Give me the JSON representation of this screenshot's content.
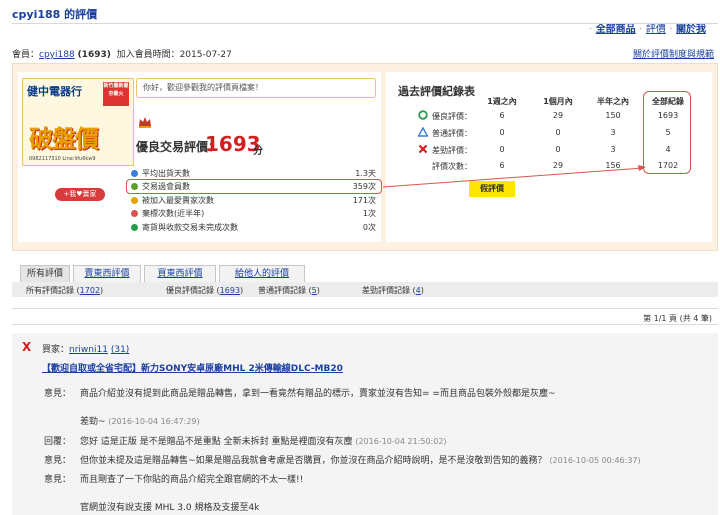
{
  "header": {
    "title": "cpyi188 的評價",
    "links": [
      "全部商品",
      "評價",
      "關於我"
    ],
    "member_prefix": "會員：",
    "member_name": "cpyi188",
    "member_count": "(1693)",
    "joined": "加入會員時間：2015-07-27",
    "rules_link": "關於評價制度與規範"
  },
  "promo": {
    "brand": "健中電器行",
    "stamp": "新竹最新最夯最火",
    "big": "破盤價",
    "small": "0982117310 Line:lifu6kw9"
  },
  "favorite_button": "+我♥賣家",
  "welcome": "你好，歡迎參觀我的評價頁檔案！",
  "rating": {
    "label": "優良交易評價：",
    "value": "1693",
    "unit": "分"
  },
  "stats": [
    {
      "label": "平均出貨天數",
      "value": "1.3天",
      "color": "#3b7dd8"
    },
    {
      "label": "交易過會員數",
      "value": "359次",
      "color": "#5aa02c"
    },
    {
      "label": "被加入最愛賣家次數",
      "value": "171次",
      "color": "#e8a000"
    },
    {
      "label": "棄標次數(近半年)",
      "value": "1次",
      "color": "#d9534f"
    },
    {
      "label": "寄貨與收款交易未完成次數",
      "value": "0次",
      "color": "#2a9d4a"
    }
  ],
  "history": {
    "title": "過去評價紀錄表",
    "columns": [
      "1週之內",
      "1個月內",
      "半年之內",
      "全部紀錄"
    ],
    "rows": [
      {
        "label": "優良評價：",
        "icon": "circle-good-icon",
        "values": [
          "6",
          "29",
          "150",
          "1693"
        ]
      },
      {
        "label": "普通評價：",
        "icon": "triangle-normal-icon",
        "values": [
          "0",
          "0",
          "3",
          "5"
        ]
      },
      {
        "label": "差勁評價：",
        "icon": "x-bad-icon",
        "values": [
          "0",
          "0",
          "3",
          "4"
        ]
      },
      {
        "label": "評價次數：",
        "icon": "",
        "values": [
          "6",
          "29",
          "156",
          "1702"
        ]
      }
    ],
    "tag": "假評價"
  },
  "tabs": [
    "所有評價",
    "賣東西評價",
    "買東西評價",
    "給他人的評價"
  ],
  "subtabs": {
    "all_label": "所有評價記錄 (",
    "all_count": "1702",
    "all_close": ")",
    "good_label": "優良評價記錄 (",
    "good_count": "1693",
    "good_close": ")",
    "normal_label": "普通評價記錄 (",
    "normal_count": "5",
    "normal_close": ")",
    "bad_label": "差勁評價記錄 (",
    "bad_count": "4",
    "bad_close": ")"
  },
  "pager": "第 1/1 頁 (共 4 筆)",
  "review": {
    "buyer_label": "買家：",
    "buyer_name": "nriwni11",
    "buyer_count": "(31)",
    "product": "【歡迎自取或全省宅配】新力SONY安卓原廠MHL 2米傳輸線DLC-MB20",
    "lines": [
      {
        "label": "意見：",
        "text": "商品介紹並沒有提到此商品是贈品轉售，拿到一看竟然有贈品的標示，賣家並沒有告知= =而且商品包裝外殼都是灰塵~",
        "time": ""
      },
      {
        "label": "",
        "text": "差勁~",
        "time": "(2016-10-04 16:47:29)"
      },
      {
        "label": "回覆：",
        "text": "您好 這是正版 是不是贈品不是重點 全新未拆封 重點是裡面沒有灰塵",
        "time": "(2016-10-04 21:50:02)"
      },
      {
        "label": "意見：",
        "text": "但你並未提及這是贈品轉售~如果是贈品我就會考慮是否購買，你並沒在商品介紹時說明，是不是沒敬到告知的義務？",
        "time": "(2016-10-05 00:46:37)"
      },
      {
        "label": "意見：",
        "text": "而且剛查了一下你貼的商品介紹完全跟官網的不太一樣!!",
        "time": ""
      },
      {
        "label": "",
        "text": "官網並沒有說支援 MHL 3.0 規格及支援至4k",
        "time": ""
      }
    ]
  }
}
